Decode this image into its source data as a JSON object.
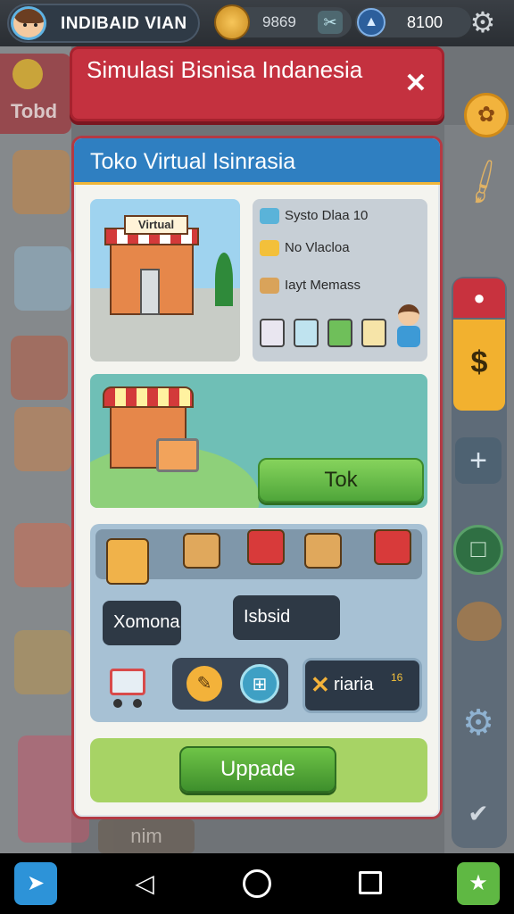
{
  "hud": {
    "player_name": "INDIBAID VIAN",
    "coins": "9869",
    "gems": "8100"
  },
  "background": {
    "tab_label": "Tobd",
    "bottom_label": "nim"
  },
  "dialog": {
    "title": "Simulasi Bisnisa Indanesia",
    "close_label": "✕",
    "panel_title": "Toko Virtual Isinrasia",
    "store_sign": "Virtual",
    "info": {
      "row1": "Systo Dlaa 10",
      "row2": "No Vlacloa",
      "row3": "Iayt Memass"
    },
    "promo": {
      "button_label": "Tok"
    },
    "items": {
      "field1": "Xomona",
      "field2": "Isbsid",
      "badge_label": "riaria",
      "badge_count": "16"
    },
    "upgrade_label": "Uppade"
  },
  "colors": {
    "banner": "#c4313f",
    "panel_header": "#2f7fc1",
    "button_green": "#4fa63a"
  }
}
